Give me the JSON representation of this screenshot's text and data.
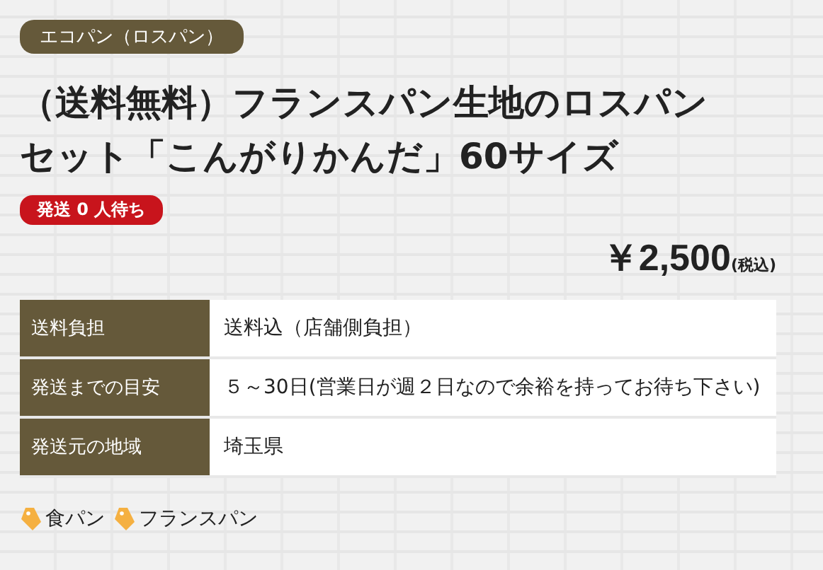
{
  "category_badge": "エコパン（ロスパン）",
  "title": "（送料無料）フランスパン生地のロスパンセット「こんがりかんだ」60サイズ",
  "waiting_badge": "発送 0 人待ち",
  "price": {
    "amount": "￥2,500",
    "tax_note": "(税込)"
  },
  "details": [
    {
      "label": "送料負担",
      "value": "送料込（店舗側負担）"
    },
    {
      "label": "発送までの目安",
      "value": "５～30日(営業日が週２日なので余裕を持ってお待ち下さい)"
    },
    {
      "label": "発送元の地域",
      "value": "埼玉県"
    }
  ],
  "tags": [
    "食パン",
    "フランスパン"
  ]
}
